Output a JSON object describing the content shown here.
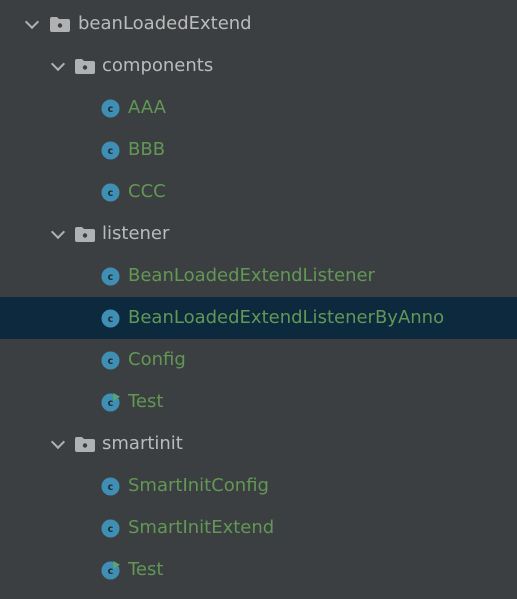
{
  "tree": {
    "root": {
      "label": "beanLoadedExtend",
      "expanded": true
    },
    "components": {
      "label": "components",
      "expanded": true,
      "items": [
        {
          "label": "AAA",
          "icon": "class-icon"
        },
        {
          "label": "BBB",
          "icon": "class-icon"
        },
        {
          "label": "CCC",
          "icon": "class-icon"
        }
      ]
    },
    "listener": {
      "label": "listener",
      "expanded": true,
      "items": [
        {
          "label": "BeanLoadedExtendListener",
          "icon": "class-icon"
        },
        {
          "label": "BeanLoadedExtendListenerByAnno",
          "icon": "class-icon",
          "selected": true
        },
        {
          "label": "Config",
          "icon": "class-icon"
        },
        {
          "label": "Test",
          "icon": "runnable-class-icon"
        }
      ]
    },
    "smartinit": {
      "label": "smartinit",
      "expanded": true,
      "items": [
        {
          "label": "SmartInitConfig",
          "icon": "class-icon"
        },
        {
          "label": "SmartInitExtend",
          "icon": "class-icon"
        },
        {
          "label": "Test",
          "icon": "runnable-class-icon"
        }
      ]
    }
  },
  "colors": {
    "background": "#3c3f41",
    "selection": "#0d293e",
    "package_text": "#bbbbbb",
    "class_text": "#629755",
    "class_icon": "#3f8fb5",
    "run_marker": "#59a869"
  }
}
